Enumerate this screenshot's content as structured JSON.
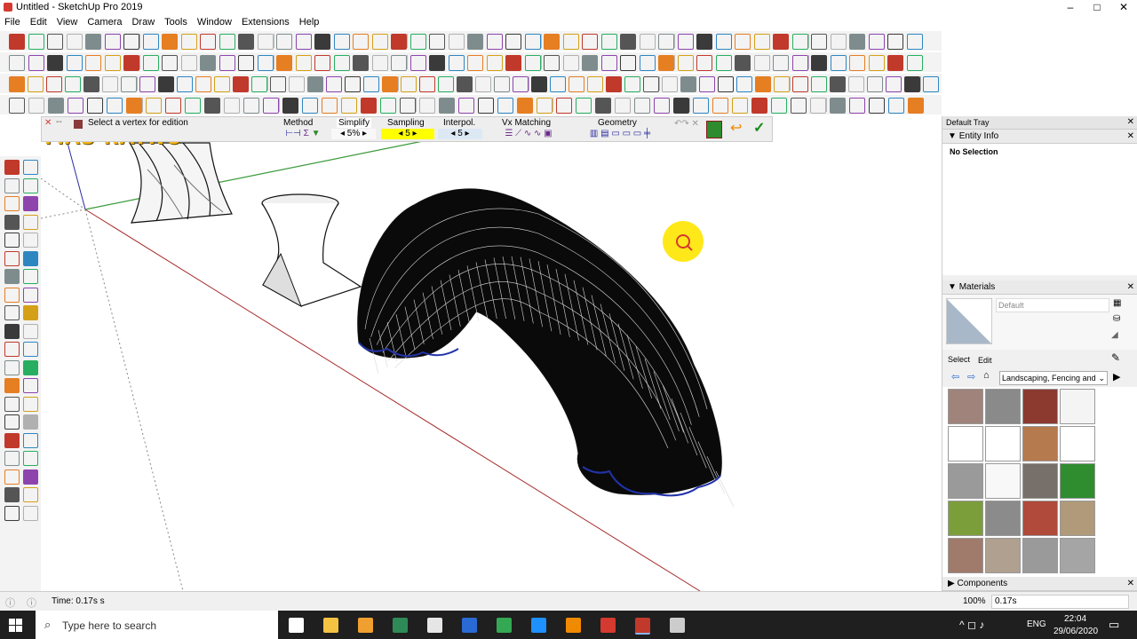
{
  "window": {
    "title": "Untitled - SketchUp Pro 2019",
    "min": "–",
    "max": "□",
    "close": "✕"
  },
  "menu": [
    "File",
    "Edit",
    "View",
    "Camera",
    "Draw",
    "Tools",
    "Window",
    "Extensions",
    "Help"
  ],
  "plugin": {
    "status": "Select a vertex for edition",
    "method_label": "Method",
    "simplify_label": "Simplify",
    "simplify_value": "5%",
    "sampling_label": "Sampling",
    "sampling_value": "5",
    "interpol_label": "Interpol.",
    "interpol_value": "5",
    "vx_label": "Vx Matching",
    "geometry_label": "Geometry"
  },
  "watermark": "MAS RATNO",
  "tray": {
    "title": "Default Tray",
    "entity_info": {
      "header": "Entity Info",
      "text": "No Selection"
    },
    "materials": {
      "header": "Materials",
      "name_value": "Default",
      "tab_select": "Select",
      "tab_edit": "Edit",
      "library": "Landscaping, Fencing and",
      "swatches": [
        "#a0837a",
        "#8a8a8a",
        "#8c3a30",
        "#f4f4f4",
        "#ffffff",
        "#ffffff",
        "#b57a4e",
        "#ffffff",
        "#9a9a9a",
        "#f8f8f8",
        "#77706a",
        "#2f8d2f",
        "#7c9e3a",
        "#8b8b8b",
        "#b04a3a",
        "#b09a7a",
        "#a07a6a",
        "#b0a090",
        "#9a9a9a",
        "#a5a5a5"
      ]
    },
    "components_header": "Components"
  },
  "status": {
    "time_text": "Time: 0.17s s",
    "zoom": "100%",
    "vcb_value": "0.17s"
  },
  "taskbar": {
    "search_placeholder": "Type here to search",
    "lang": "ENG",
    "time": "22:04",
    "date": "29/06/2020"
  },
  "colors": {
    "accent_plugin": "#ffff00",
    "axis_red": "#a52a2a",
    "axis_green": "#3a9a3a",
    "axis_blue": "#2a2aa0",
    "watermark": "#f2b718"
  }
}
